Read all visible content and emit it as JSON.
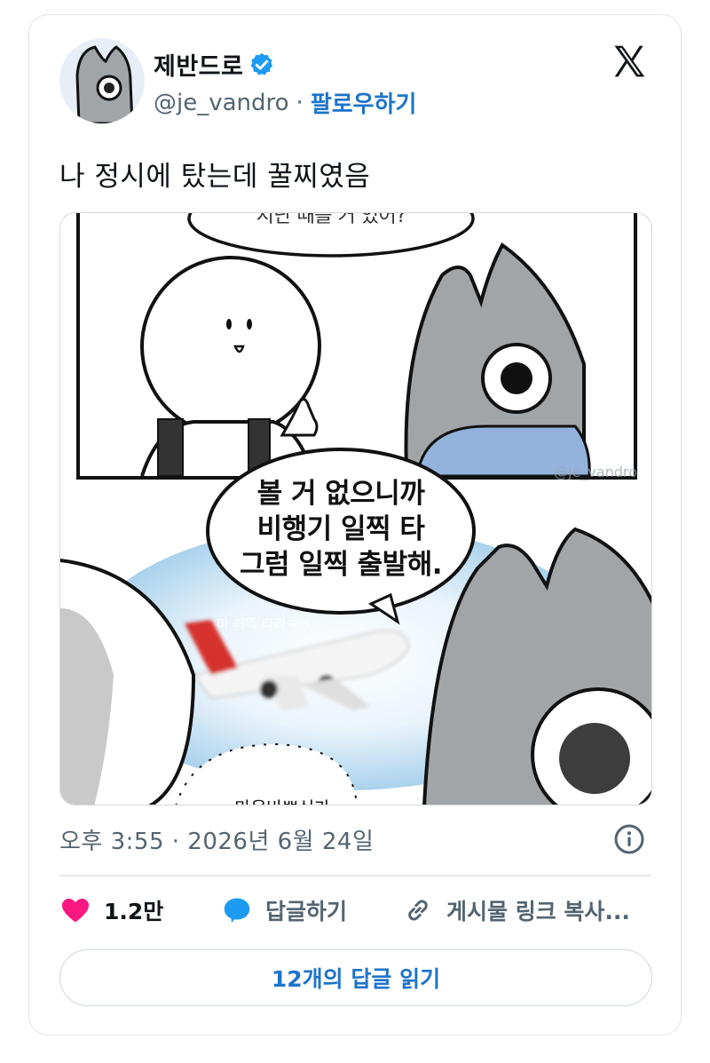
{
  "user": {
    "display_name": "제반드로",
    "handle": "@je_vandro",
    "separator": "·",
    "follow_label": "팔로우하기"
  },
  "tweet": {
    "text": "나 정시에 탔는데 꿀찌였음",
    "timestamp": "오후 3:55 · 2026년 6월 24일"
  },
  "media": {
    "top_bubble_text": "지난 때를 거 있어?",
    "main_bubble_lines": [
      "볼 거 없으니까",
      "비행기 일찍 타",
      "그럼 일찍 출발해."
    ],
    "plane_caption": "마 퍼뜩 타라ㅋㅋ",
    "watermark": "@je_vandro",
    "bottom_bubble_text": "마음바쁘신가"
  },
  "actions": {
    "likes_count": "1.2만",
    "reply_label": "답글하기",
    "copy_link_label": "게시물 링크 복사..."
  },
  "read_replies_label": "12개의 답글 읽기",
  "colors": {
    "accent": "#1d74c9",
    "heart": "#f91880",
    "reply_bubble": "#1d9bf0",
    "muted": "#536471"
  },
  "icons": {
    "verified": "verified-badge-icon",
    "logo": "x-logo-icon",
    "info": "info-icon",
    "like": "heart-icon",
    "reply": "speech-bubble-icon",
    "link": "link-icon"
  }
}
